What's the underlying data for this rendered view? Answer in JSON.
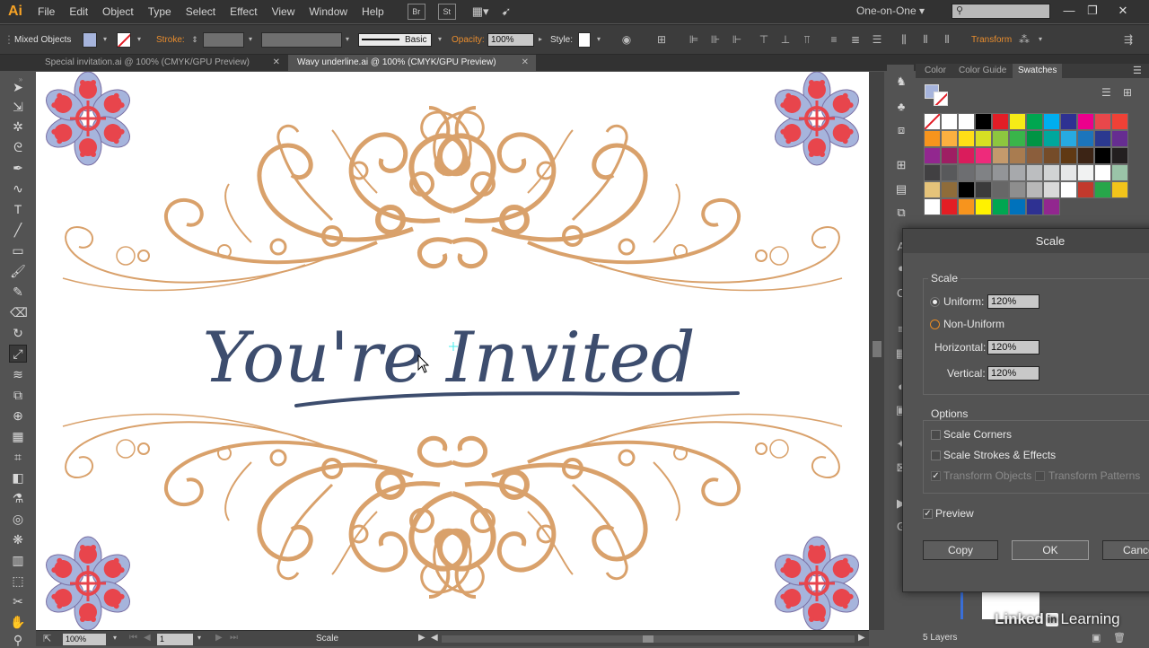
{
  "app": {
    "logo": "Ai"
  },
  "menu": [
    "File",
    "Edit",
    "Object",
    "Type",
    "Select",
    "Effect",
    "View",
    "Window",
    "Help"
  ],
  "bridge_buttons": [
    "Br",
    "St"
  ],
  "workspace": "One-on-One",
  "search": {
    "placeholder": ""
  },
  "control_bar": {
    "selection_label": "Mixed Objects",
    "stroke_label": "Stroke:",
    "brush_label": "Basic",
    "opacity_label": "Opacity:",
    "opacity_value": "100%",
    "style_label": "Style:",
    "transform_label": "Transform"
  },
  "tabs": [
    {
      "label": "Special invitation.ai @ 100% (CMYK/GPU Preview)",
      "active": false
    },
    {
      "label": "Wavy underline.ai @ 100% (CMYK/GPU Preview)",
      "active": true
    }
  ],
  "artwork": {
    "headline": "You're Invited"
  },
  "status_bar": {
    "zoom": "100%",
    "page": "1",
    "status": "Scale"
  },
  "panel_tabs": [
    "Color",
    "Color Guide",
    "Swatches"
  ],
  "layers": {
    "count_label": "5 Layers"
  },
  "dialog": {
    "title": "Scale",
    "scale_group": "Scale",
    "uniform_label": "Uniform:",
    "uniform_value": "120%",
    "nonuniform_label": "Non-Uniform",
    "horizontal_label": "Horizontal:",
    "horizontal_value": "120%",
    "vertical_label": "Vertical:",
    "vertical_value": "120%",
    "options_group": "Options",
    "scale_corners": "Scale Corners",
    "scale_strokes": "Scale Strokes & Effects",
    "transform_objects": "Transform Objects",
    "transform_patterns": "Transform Patterns",
    "preview": "Preview",
    "copy_button": "Copy",
    "ok_button": "OK",
    "cancel_button": "Cancel"
  },
  "watermark": {
    "brand": "Linked",
    "in": "in",
    "learning": "Learning"
  },
  "colors": {
    "ornament": "#d9a16b",
    "headline": "#3d4d6e",
    "flower_red": "#e8454c",
    "flower_blue": "#a6b4dc",
    "orange_label": "#e98d2e"
  },
  "swatches": [
    [
      "none",
      "#ffffff",
      "#ffffff",
      "#000000",
      "#e21d26",
      "#f6eb16",
      "#00a650",
      "#00aeef",
      "#2e3192",
      "#ec008c",
      "#e8474b",
      "#ef4136"
    ],
    [
      "#f7941d",
      "#fbb040",
      "#ffde17",
      "#d7df23",
      "#8dc63f",
      "#39b54a",
      "#009444",
      "#00a79d",
      "#27aae1",
      "#1c75bc",
      "#2b3990",
      "#662d91"
    ],
    [
      "#92278f",
      "#9e1f63",
      "#da1c5c",
      "#ee2a7b",
      "#c49a6c",
      "#a97c50",
      "#8b5e3c",
      "#754c29",
      "#603913",
      "#3c2415",
      "#000000",
      "#231f20"
    ],
    [
      "#414042",
      "#58595b",
      "#6d6e71",
      "#808285",
      "#939598",
      "#a7a9ac",
      "#bcbec0",
      "#d1d3d4",
      "#e6e7e8",
      "#f1f2f2",
      "#ffffff",
      "#9ac4a8"
    ],
    [
      "#e5c37a",
      "#8f6c3a",
      "#000000",
      "#3b3b3b",
      "#676767",
      "#8e8e8e",
      "#b8b8b8",
      "#d9d9d9",
      "#ffffff",
      "#c2392c",
      "#27a64a",
      "#f2c41b"
    ],
    [
      "#ffffff",
      "#e31e24",
      "#f7941d",
      "#fff200",
      "#00a651",
      "#0072bc",
      "#2e3192",
      "#92278f"
    ]
  ]
}
